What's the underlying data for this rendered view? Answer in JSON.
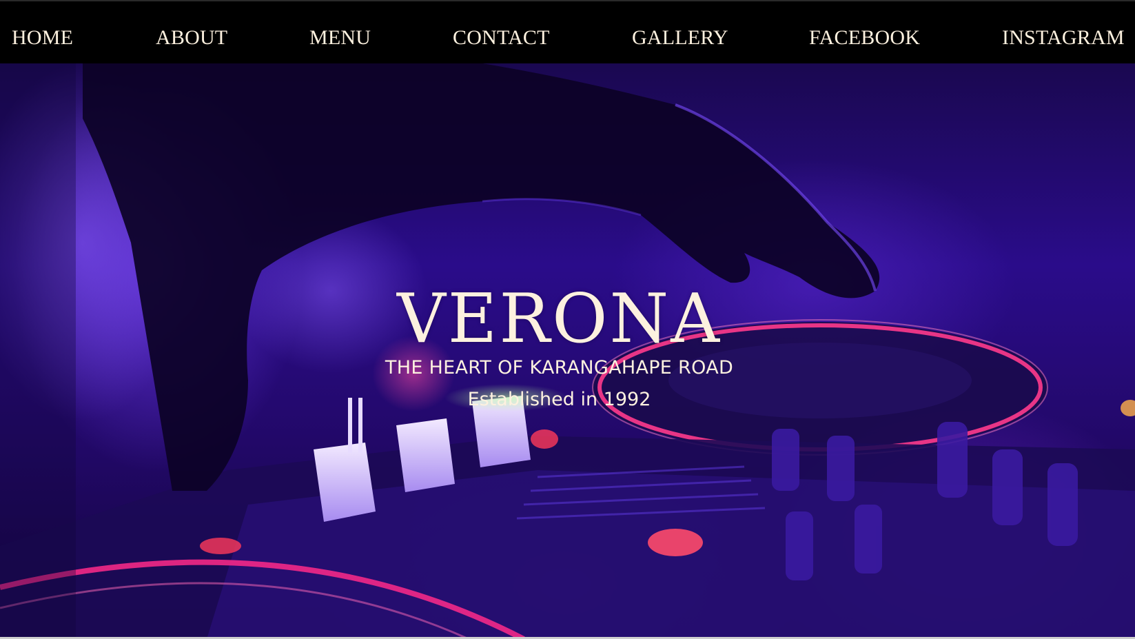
{
  "nav": {
    "items": [
      {
        "label": "HOME"
      },
      {
        "label": "ABOUT"
      },
      {
        "label": "MENU"
      },
      {
        "label": "CONTACT"
      },
      {
        "label": "GALLERY"
      },
      {
        "label": "FACEBOOK"
      },
      {
        "label": "INSTAGRAM"
      }
    ]
  },
  "hero": {
    "title": "VERONA",
    "subtitle": "THE HEART OF KARANGAHAPE ROAD",
    "established": "Established in 1992",
    "background_image": "dj-mixer-hand-photo"
  },
  "colors": {
    "nav_background": "#000000",
    "text": "#fdf1df",
    "hero_tint": "#3a12b0",
    "accent_pink": "#ff2a8a"
  }
}
